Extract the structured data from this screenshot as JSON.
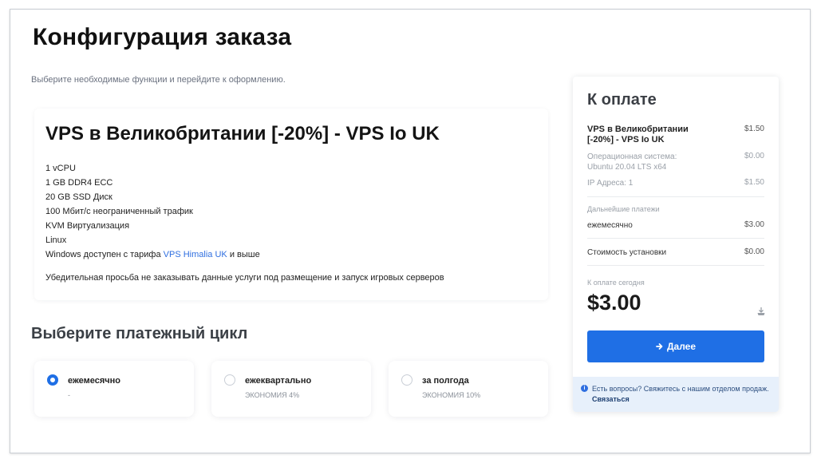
{
  "page": {
    "title": "Конфигурация заказа",
    "subtitle": "Выберите необходимые функции и перейдите к оформлению."
  },
  "product": {
    "name": "VPS в Великобритании [-20%] - VPS Io UK",
    "features": [
      "1 vCPU",
      "1 GB DDR4 ECC",
      "20 GB SSD Диск",
      "100 Мбит/с неограниченный трафик",
      "KVM Виртуализация",
      "Linux"
    ],
    "windows_prefix": "Windows доступен с тарифа",
    "windows_link": "VPS Himalia UK",
    "windows_suffix": "и выше",
    "notice": "Убедительная просьба не заказывать данные услуги под размещение и запуск игровых серверов"
  },
  "billing": {
    "title": "Выберите платежный цикл",
    "options": [
      {
        "label": "ежемесячно",
        "sub": "-",
        "selected": true
      },
      {
        "label": "ежеквартально",
        "sub": "ЭКОНОМИЯ 4%",
        "selected": false
      },
      {
        "label": "за полгода",
        "sub": "ЭКОНОМИЯ 10%",
        "selected": false
      }
    ]
  },
  "summary": {
    "title": "К оплате",
    "product_line": "VPS в Великобритании [-20%] - VPS Io UK",
    "product_price": "$1.50",
    "os_label": "Операционная система: Ubuntu 20.04 LTS x64",
    "os_price": "$0.00",
    "ip_label": "IP Адреса: 1",
    "ip_price": "$1.50",
    "recurring_label": "Дальнейшие платежи",
    "monthly_label": "ежемесячно",
    "monthly_price": "$3.00",
    "setup_label": "Стоимость установки",
    "setup_price": "$0.00",
    "today_label": "К оплате сегодня",
    "today_amount": "$3.00",
    "next_button": "Далее",
    "help_text": "Есть вопросы? Свяжитесь с нашим отделом продаж.",
    "help_link": "Связаться"
  },
  "colors": {
    "accent": "#1f6fe5",
    "link": "#2f6fe0",
    "help_bg": "#e7f0fb"
  }
}
